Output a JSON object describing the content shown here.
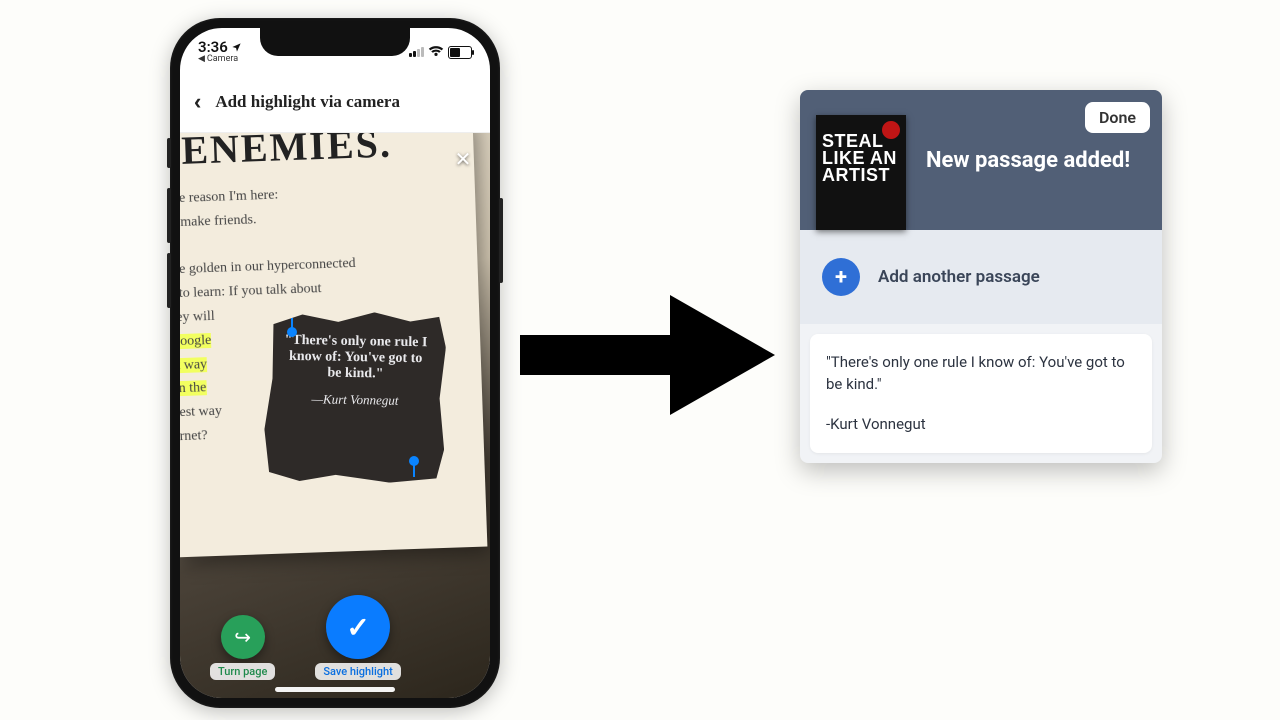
{
  "status": {
    "time": "3:36",
    "breadcrumb": "Camera"
  },
  "app": {
    "header_title": "Add highlight via camera",
    "close_x": "✕",
    "turn_page_label": "Turn page",
    "save_label": "Save highlight"
  },
  "page_photo": {
    "heading": "ENEMIES.",
    "body_html": "one reason I'm here:<br>to make friends.<br><br>ore golden in our hyperconnected<br>n to learn: If you talk about<br>hey will<br><span class='hl'>Google</span><br><span class='hl'>st way</span><br><span class='hl'>on the</span><br>best way<br>ernet?"
  },
  "selection": {
    "quote": "\"There's only one rule I know of: You've got to be kind.\"",
    "attribution": "—Kurt Vonnegut"
  },
  "result": {
    "done_label": "Done",
    "book_title_lines": "STEAL\nLIKE AN\nARTIST",
    "headline": "New passage added!",
    "add_another_label": "Add another passage",
    "passage_text": "\"There's only one rule I know of: You've got to be kind.\"",
    "passage_attr": "-Kurt Vonnegut"
  }
}
